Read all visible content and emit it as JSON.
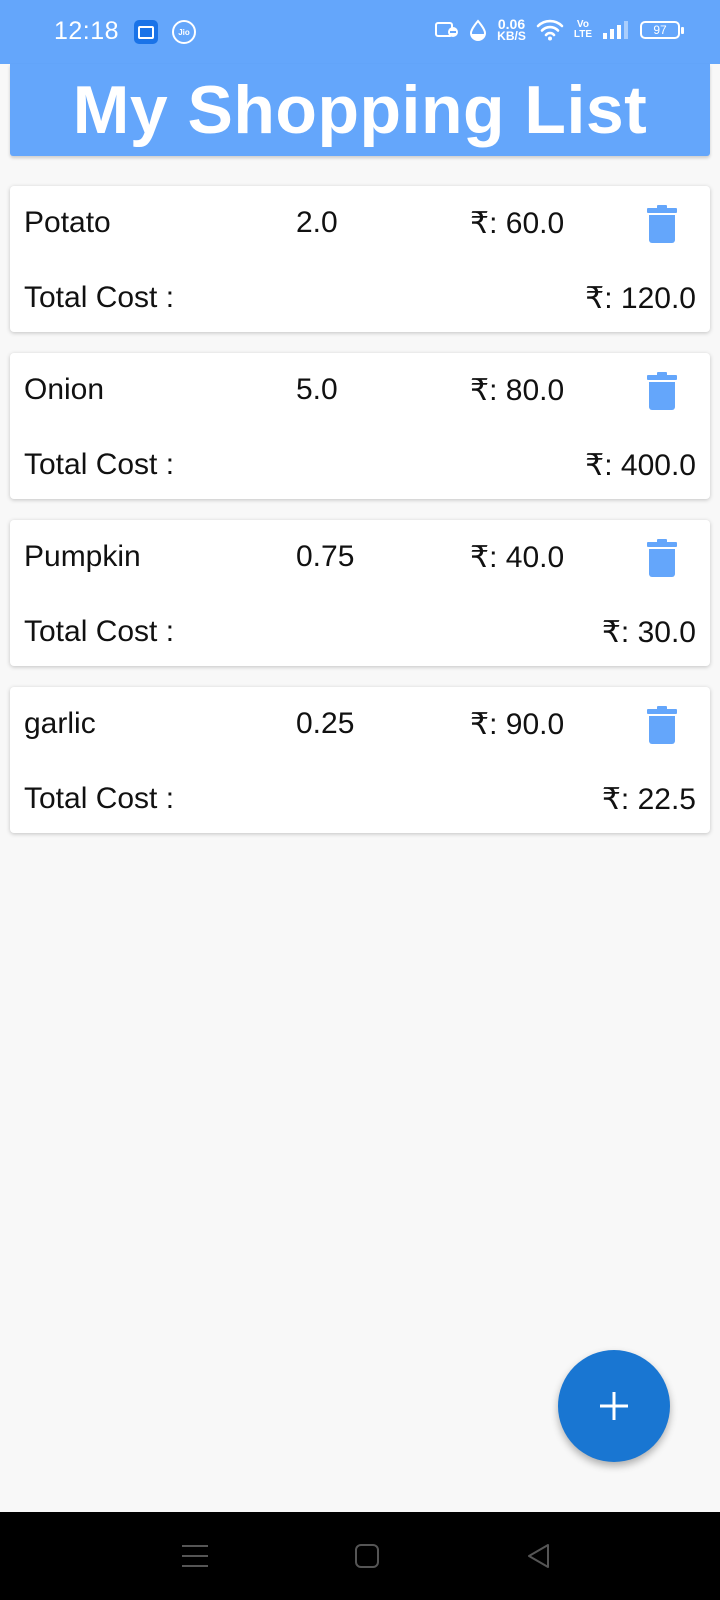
{
  "status_bar": {
    "time": "12:18",
    "jio_label": "Jio",
    "net_speed_value": "0.06",
    "net_speed_unit": "KB/S",
    "volte_top": "Vo",
    "volte_bottom": "LTE",
    "battery": "97"
  },
  "header": {
    "title": "My Shopping List"
  },
  "items": [
    {
      "name": "Potato",
      "qty": "2.0",
      "price": "₹: 60.0",
      "total_label": "Total Cost :",
      "total": "₹: 120.0"
    },
    {
      "name": "Onion",
      "qty": "5.0",
      "price": "₹: 80.0",
      "total_label": "Total Cost :",
      "total": "₹: 400.0"
    },
    {
      "name": "Pumpkin",
      "qty": "0.75",
      "price": "₹: 40.0",
      "total_label": "Total Cost :",
      "total": "₹: 30.0"
    },
    {
      "name": "garlic",
      "qty": "0.25",
      "price": "₹: 90.0",
      "total_label": "Total Cost :",
      "total": "₹: 22.5"
    }
  ],
  "icons": {
    "delete": "trash-icon",
    "add": "plus-icon",
    "nav_menu": "menu-icon",
    "nav_home": "home-icon",
    "nav_back": "back-icon"
  },
  "colors": {
    "header_bg": "#64a6fb",
    "fab_bg": "#1976d2",
    "trash": "#64a6fb"
  }
}
